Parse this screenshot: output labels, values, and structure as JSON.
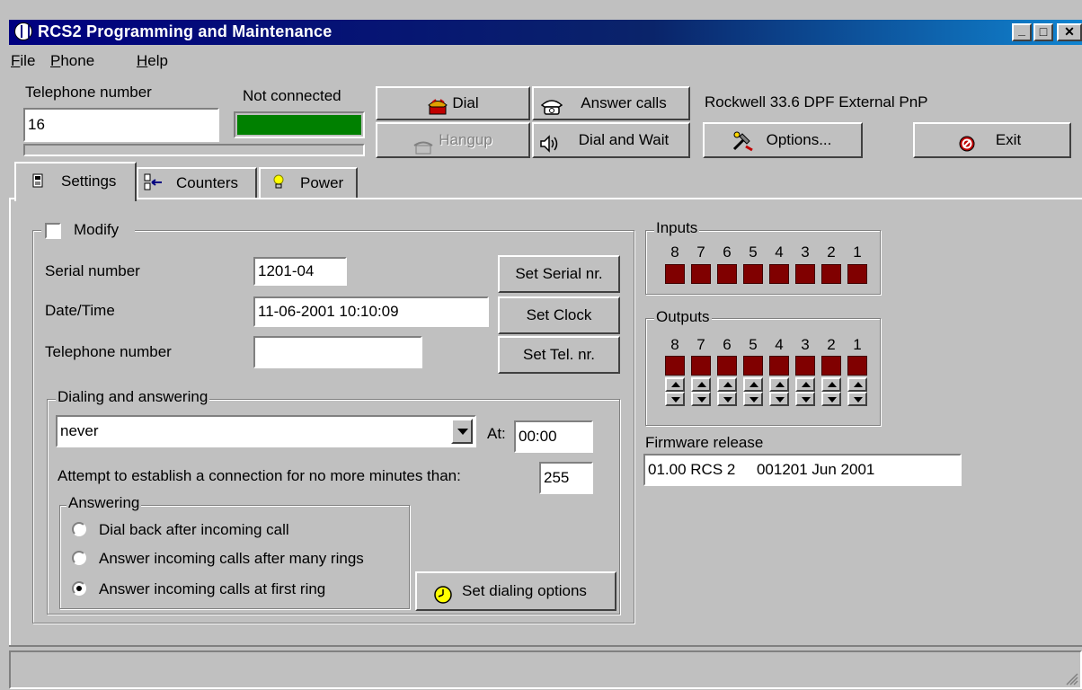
{
  "window": {
    "title": "RCS2 Programming and Maintenance",
    "controls": {
      "minimize": "_",
      "maximize": "□",
      "close": "✕"
    }
  },
  "menu": {
    "items": [
      {
        "label": "File",
        "accel": "F"
      },
      {
        "label": "Phone",
        "accel": "P"
      },
      {
        "label": "Help",
        "accel": "H"
      }
    ]
  },
  "connection": {
    "phone_label": "Telephone number",
    "phone_value": "16",
    "status_label": "Not connected",
    "status_color": "#008000",
    "modem": "Rockwell 33.6 DPF External PnP"
  },
  "toolbar": {
    "dial": "Dial",
    "hangup": "Hangup",
    "answer_calls": "Answer calls",
    "dial_and_wait": "Dial and Wait",
    "options": "Options...",
    "exit": "Exit"
  },
  "tabs": [
    {
      "label": "Settings",
      "active": true
    },
    {
      "label": "Counters",
      "active": false
    },
    {
      "label": "Power",
      "active": false
    }
  ],
  "settings": {
    "modify_label": "Modify",
    "modify_checked": false,
    "serial_label": "Serial number",
    "serial_value": "1201-04",
    "datetime_label": "Date/Time",
    "datetime_value": "11-06-2001 10:10:09",
    "tel_label": "Telephone number",
    "tel_value": "",
    "set_serial": "Set Serial nr.",
    "set_clock": "Set Clock",
    "set_tel": "Set Tel. nr.",
    "dialing_group": "Dialing and answering",
    "dial_mode": "never",
    "at_label": "At:",
    "at_value": "00:00",
    "attempt_label": "Attempt to establish a connection for no more minutes than:",
    "attempt_value": "255",
    "answering_group": "Answering",
    "answering_options": [
      {
        "label": "Dial back after incoming call",
        "checked": false
      },
      {
        "label": "Answer incoming calls after many rings",
        "checked": false
      },
      {
        "label": "Answer incoming calls at first ring",
        "checked": true
      }
    ],
    "set_dialing_options": "Set dialing options"
  },
  "io": {
    "inputs_label": "Inputs",
    "outputs_label": "Outputs",
    "channels": [
      "8",
      "7",
      "6",
      "5",
      "4",
      "3",
      "2",
      "1"
    ],
    "led_color": "#800000"
  },
  "firmware": {
    "label": "Firmware release",
    "value": "01.00 RCS 2     001201 Jun 2001"
  }
}
